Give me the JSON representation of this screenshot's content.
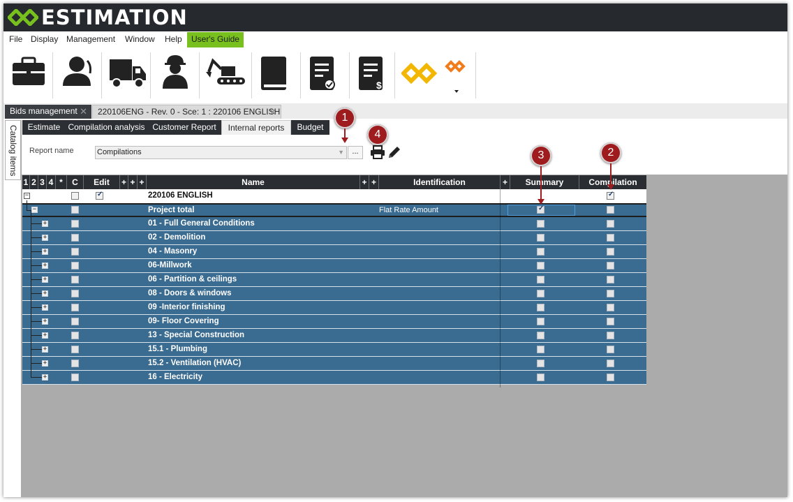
{
  "app": {
    "title": "ESTIMATION"
  },
  "menu": {
    "items": [
      "File",
      "Display",
      "Management",
      "Window",
      "Help"
    ],
    "guide_label": "User's Guide"
  },
  "toolbar": {
    "icons": [
      "briefcase-icon",
      "client-icon",
      "truck-icon",
      "worker-icon",
      "excavator-icon",
      "book-icon",
      "document-check-icon",
      "document-dollar-icon",
      "logo-yellow-icon",
      "logo-orange-icon"
    ]
  },
  "doc_tabs": [
    {
      "label": "Bids management"
    },
    {
      "label": "220106ENG - Rev. 0 - Sce: 1 : 220106 ENGLISH"
    }
  ],
  "side_panel": {
    "label": "Catalog items"
  },
  "inner_tabs": [
    "Estimate",
    "Compilation analysis",
    "Customer Report",
    "Internal reports",
    "Budget"
  ],
  "report": {
    "label": "Report name",
    "value": "Compilations",
    "more": "..."
  },
  "grid": {
    "headers": {
      "levels": [
        "1",
        "2",
        "3",
        "4",
        "*"
      ],
      "c": "C",
      "edit": "Edit",
      "plus": "+",
      "name": "Name",
      "identification": "Identification",
      "summary": "Summary",
      "compilation": "Compilation"
    },
    "root": {
      "name": "220106 ENGLISH",
      "edit": true,
      "compilation": true
    },
    "project_total": {
      "name": "Project total",
      "identification": "Flat Rate Amount",
      "summary": true
    },
    "rows": [
      "01 - Full General Conditions",
      "02 - Demolition",
      "04 - Masonry",
      "06-Millwork",
      "06 - Partition & ceilings",
      "08 - Doors & windows",
      "09 -Interior finishing",
      "09- Floor Covering",
      "13 - Special Construction",
      "15.1 - Plumbing",
      "15.2 - Ventilation (HVAC)",
      "16 - Electricity"
    ]
  },
  "callouts": [
    "1",
    "2",
    "3",
    "4"
  ],
  "colors": {
    "titlebar": "#26292e",
    "accent_green": "#78c01e",
    "row_blue": "#3a6b91",
    "callout": "#9e1b1e",
    "logo_yellow": "#f2b705",
    "logo_orange": "#f07c1b"
  }
}
